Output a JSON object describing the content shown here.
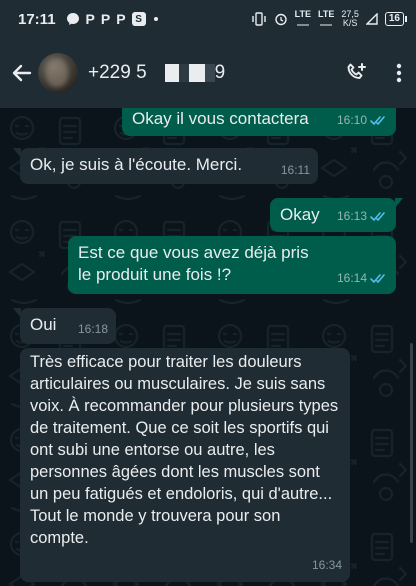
{
  "status_bar": {
    "time": "17:11",
    "left_badges": [
      "P",
      "P",
      "P",
      "S"
    ],
    "lte1": "LTE",
    "lte2": "LTE",
    "speed_value": "27,5",
    "speed_unit": "K/S",
    "battery": "16"
  },
  "header": {
    "contact_name": "+229 5",
    "contact_name_tail": "9"
  },
  "messages": [
    {
      "direction": "out",
      "text": "Okay il vous contactera",
      "time": "16:10"
    },
    {
      "direction": "in",
      "text": "Ok, je suis à l'écoute. Merci.",
      "time": "16:11"
    },
    {
      "direction": "out",
      "text": "Okay",
      "time": "16:13"
    },
    {
      "direction": "out",
      "text": "Est ce que vous avez déjà pris le produit une fois !?",
      "time": "16:14"
    },
    {
      "direction": "in",
      "text": "Oui",
      "time": "16:18"
    },
    {
      "direction": "in",
      "text": "Très efficace pour traiter les douleurs articulaires ou musculaires. Je suis sans voix. À recommander pour plusieurs types de traitement. Que ce soit les sportifs qui ont subi une entorse ou autre, les personnes âgées dont les muscles sont un peu fatigués et endoloris, qui d'autre... Tout le monde y trouvera pour son compte.",
      "time": "16:34"
    }
  ],
  "colors": {
    "header_bg": "#1f2c34",
    "chat_bg": "#0b141a",
    "outgoing_bubble": "#005c4b",
    "incoming_bubble": "#202c33",
    "read_ticks": "#53bdeb"
  }
}
